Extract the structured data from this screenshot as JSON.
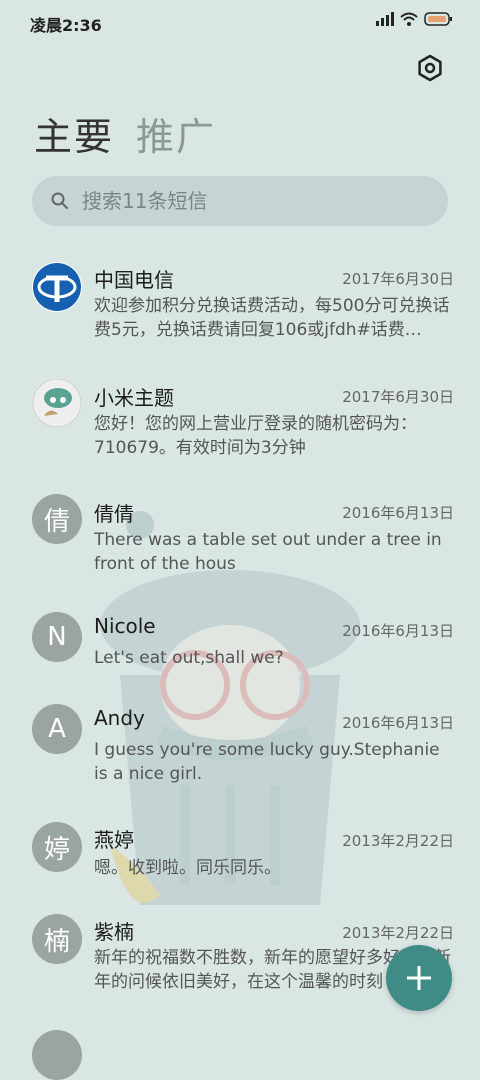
{
  "status_bar": {
    "time": "凌晨2:36"
  },
  "tabs": {
    "primary": "主要",
    "promo": "推广"
  },
  "search": {
    "placeholder": "搜索11条短信"
  },
  "messages": [
    {
      "avatar": "",
      "name": "中国电信",
      "date": "2017年6月30日",
      "preview": "欢迎参加积分兑换话费活动，每500分可兑换话费5元，兑换话费请回复106或jfdh#话费…"
    },
    {
      "avatar": "",
      "name": "小米主题",
      "date": "2017年6月30日",
      "preview": "您好！您的网上营业厅登录的随机密码为：710679。有效时间为3分钟"
    },
    {
      "avatar": "倩",
      "name": "倩倩",
      "date": "2016年6月13日",
      "preview": "There was a table set out under a tree in front of the hous"
    },
    {
      "avatar": "N",
      "name": "Nicole",
      "date": "2016年6月13日",
      "preview": "Let's eat out,shall we?"
    },
    {
      "avatar": "A",
      "name": "Andy",
      "date": "2016年6月13日",
      "preview": "I guess you're some lucky guy.Stephanie is a nice girl."
    },
    {
      "avatar": "婷",
      "name": "燕婷",
      "date": "2013年2月22日",
      "preview": "嗯。收到啦。同乐同乐。"
    },
    {
      "avatar": "楠",
      "name": "紫楠",
      "date": "2013年2月22日",
      "preview": "新年的祝福数不胜数，新年的愿望好多好多，新年的问候依旧美好，在这个温馨的时刻"
    }
  ],
  "colors": {
    "background": "#d9e6e4",
    "fab": "#3f8c86",
    "avatar": "#9aa4a3"
  }
}
